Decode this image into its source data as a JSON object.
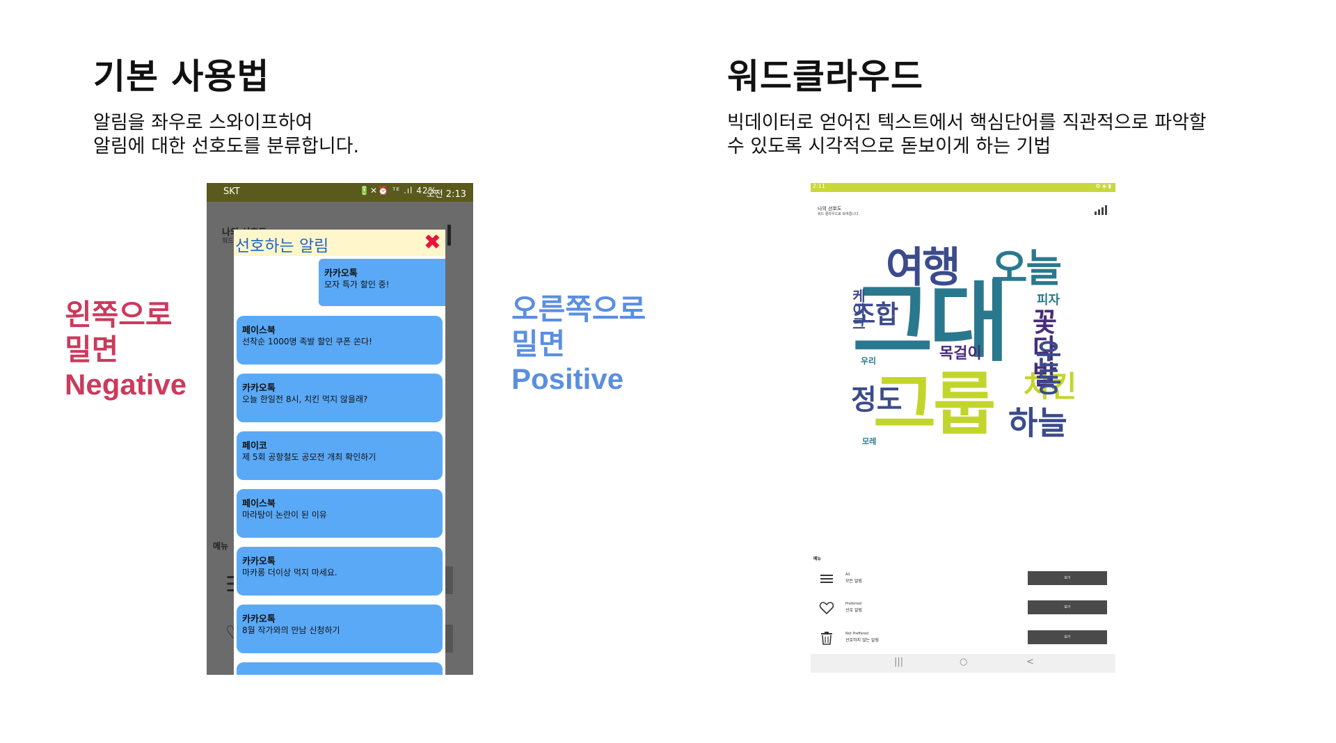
{
  "left": {
    "heading": "기본 사용법",
    "description_line1": "알림을 좌우로 스와이프하여",
    "description_line2": "알림에 대한 선호도를 분류합니다.",
    "swipe_left": {
      "line1": "왼쪽으로",
      "line2": "밀면",
      "line3": "Negative"
    },
    "swipe_right": {
      "line1": "오른쪽으로",
      "line2": "밀면",
      "line3": "Positive"
    },
    "phone": {
      "carrier": "SKT",
      "status_icons": "🔋✕⏰ ᵀᴱ .ıl 42%",
      "time": "오전 2:13",
      "bg_title": "나의 선호도",
      "bg_subtitle": "워드",
      "bg_menu": "메뉴",
      "dialog_title": "선호하는 알림",
      "close_glyph": "✖",
      "cards": [
        {
          "from": "카카오톡",
          "msg": "모자 특가 할인 중!"
        },
        {
          "from": "페이스북",
          "msg": "선착순 1000명 족발 할인 쿠폰 쏜다!"
        },
        {
          "from": "카카오톡",
          "msg": "오늘 한일전 8시, 치킨 먹지 않을래?"
        },
        {
          "from": "페이코",
          "msg": "제 5회 공항철도 공모전 개최 확인하기"
        },
        {
          "from": "페이스북",
          "msg": "마라탕이 논란이 된 이유"
        },
        {
          "from": "카카오톡",
          "msg": "마카롱 더이상 먹지 마세요."
        },
        {
          "from": "카카오톡",
          "msg": "8월 작가와의 만남 신청하기"
        }
      ]
    }
  },
  "right": {
    "heading": "워드클라우드",
    "description_line1": "빅데이터로 얻어진 텍스트에서 핵심단어를 직관적으로 파악할",
    "description_line2": "수 있도록 시각적으로 돋보이게 하는 기법",
    "tablet": {
      "time": "2:11",
      "status_icons": "⚙ ◈ ▮",
      "title": "나의 선호도",
      "subtitle": "워드 클라우드로 보여줍니다",
      "menu_label": "메뉴",
      "rows": [
        {
          "icon": "list-icon",
          "en": "All",
          "ko": "모든 알림",
          "button": "보기"
        },
        {
          "icon": "heart-icon",
          "en": "Preferred",
          "ko": "선호 알림",
          "button": "보기"
        },
        {
          "icon": "trash-icon",
          "en": "Not Preffered",
          "ko": "선호하지 않는 알림",
          "button": "보기"
        }
      ],
      "nav": {
        "recent": "|||",
        "home": "○",
        "back": "<"
      }
    },
    "word_cloud": {
      "words": [
        "그대",
        "그룹",
        "여행",
        "오늘",
        "조합",
        "정도",
        "치킨",
        "하늘",
        "목걸이",
        "피자",
        "우리",
        "모레",
        "케이크",
        "꽃다발",
        "운동"
      ],
      "colors": {
        "lime": "#c2d52b",
        "teal": "#2a788e",
        "navy": "#3b4b8c",
        "purple": "#472c7a",
        "green": "#3fbc73"
      }
    }
  }
}
